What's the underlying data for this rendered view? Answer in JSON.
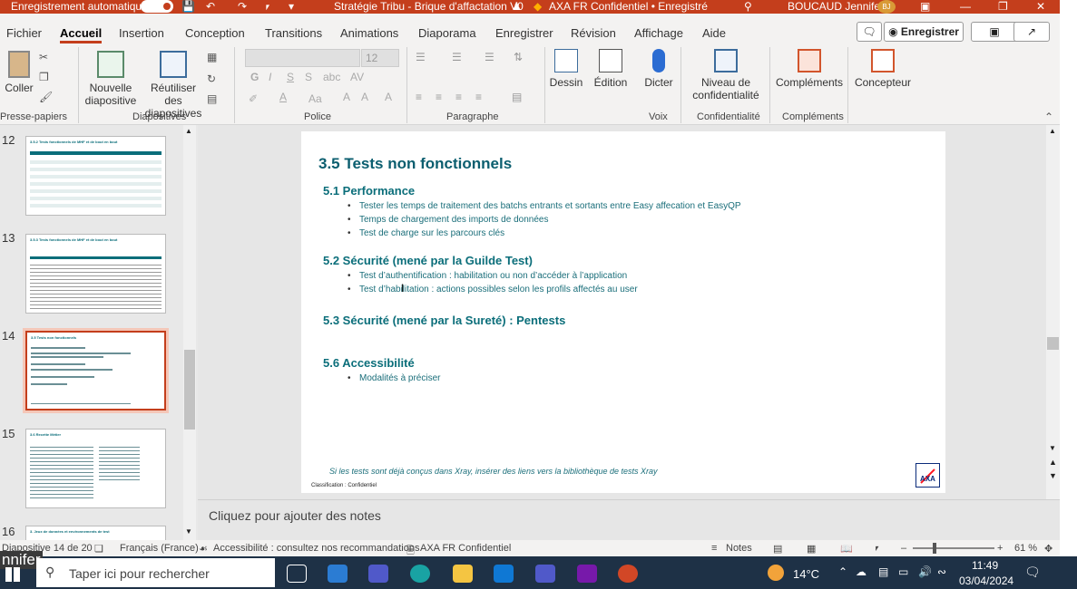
{
  "titlebar": {
    "autosave_label": "Enregistrement automatique",
    "doc_title": "Stratégie Tribu - Brique d'affactation V0",
    "sensitivity": "AXA FR Confidentiel • Enregistré",
    "user_name": "BOUCAUD Jennifer",
    "user_initials": "BJ"
  },
  "tabs": [
    "Fichier",
    "Accueil",
    "Insertion",
    "Conception",
    "Transitions",
    "Animations",
    "Diaporama",
    "Enregistrer",
    "Révision",
    "Affichage",
    "Aide"
  ],
  "tab_buttons": {
    "record": "Enregistrer"
  },
  "ribbon": {
    "coller": "Coller",
    "nouvelle_diapo": [
      "Nouvelle",
      "diapositive"
    ],
    "reutiliser": [
      "Réutiliser des",
      "diapositives"
    ],
    "font_size": "12",
    "dessin": "Dessin",
    "edition": "Édition",
    "dicter": "Dicter",
    "niveau": [
      "Niveau de",
      "confidentialité"
    ],
    "complements": "Compléments",
    "concepteur": "Concepteur",
    "groups": [
      "Presse-papiers",
      "Diapositives",
      "Police",
      "Paragraphe",
      "Voix",
      "Confidentialité",
      "Compléments"
    ]
  },
  "thumbnails": [
    {
      "num": "12",
      "title": "3.5.2 Tests fonctionnels de MHF et de bout en bout"
    },
    {
      "num": "13",
      "title": "3.5.3 Tests fonctionnels de MHF et de bout en bout"
    },
    {
      "num": "14",
      "title": "3.5 Tests non fonctionnels"
    },
    {
      "num": "15",
      "title": "3.6 Recette Métier"
    },
    {
      "num": "16",
      "title": "3. Jeux de données et environnements de test"
    }
  ],
  "slide": {
    "title": "3.5 Tests non fonctionnels",
    "sections": [
      {
        "heading": "5.1 Performance",
        "bullets": [
          "Tester les temps de traitement des batchs entrants et sortants entre Easy affecation et EasyQP",
          "Temps de chargement des imports de données",
          "Test de charge sur les parcours clés"
        ]
      },
      {
        "heading": "5.2 Sécurité (mené par la Guilde Test)",
        "bullets": [
          "Test d’authentification : habilitation ou non d’accéder à l’application",
          "Test d’habilitation : actions possibles selon les profils affectés au user"
        ]
      },
      {
        "heading": "5.3 Sécurité (mené par la Sureté) : Pentests",
        "bullets": []
      },
      {
        "heading": "5.6 Accessibilité",
        "bullets": [
          "Modalités à préciser"
        ]
      }
    ],
    "footer_note": "Si les tests sont déjà conçus dans Xray, insérer des liens vers la bibliothèque de tests Xray",
    "classification": "Classification : Confidentiel",
    "logo_text": "AXA"
  },
  "notes_placeholder": "Cliquez pour ajouter des notes",
  "status": {
    "slide_count": "Diapositive 14 de 20",
    "language": "Français (France)",
    "accessibility": "Accessibilité : consultez nos recommandations",
    "sensitivity": "AXA FR Confidentiel",
    "notes_btn": "Notes",
    "zoom": "61 %"
  },
  "taskbar": {
    "left_text": "nnifer",
    "search_placeholder": "Taper ici pour rechercher",
    "temperature": "14°C",
    "time": "11:49",
    "date": "03/04/2024"
  },
  "colors": {
    "accent": "#c43e1c",
    "slide_title": "#0b5e6f",
    "slide_text": "#1a6e7a"
  }
}
